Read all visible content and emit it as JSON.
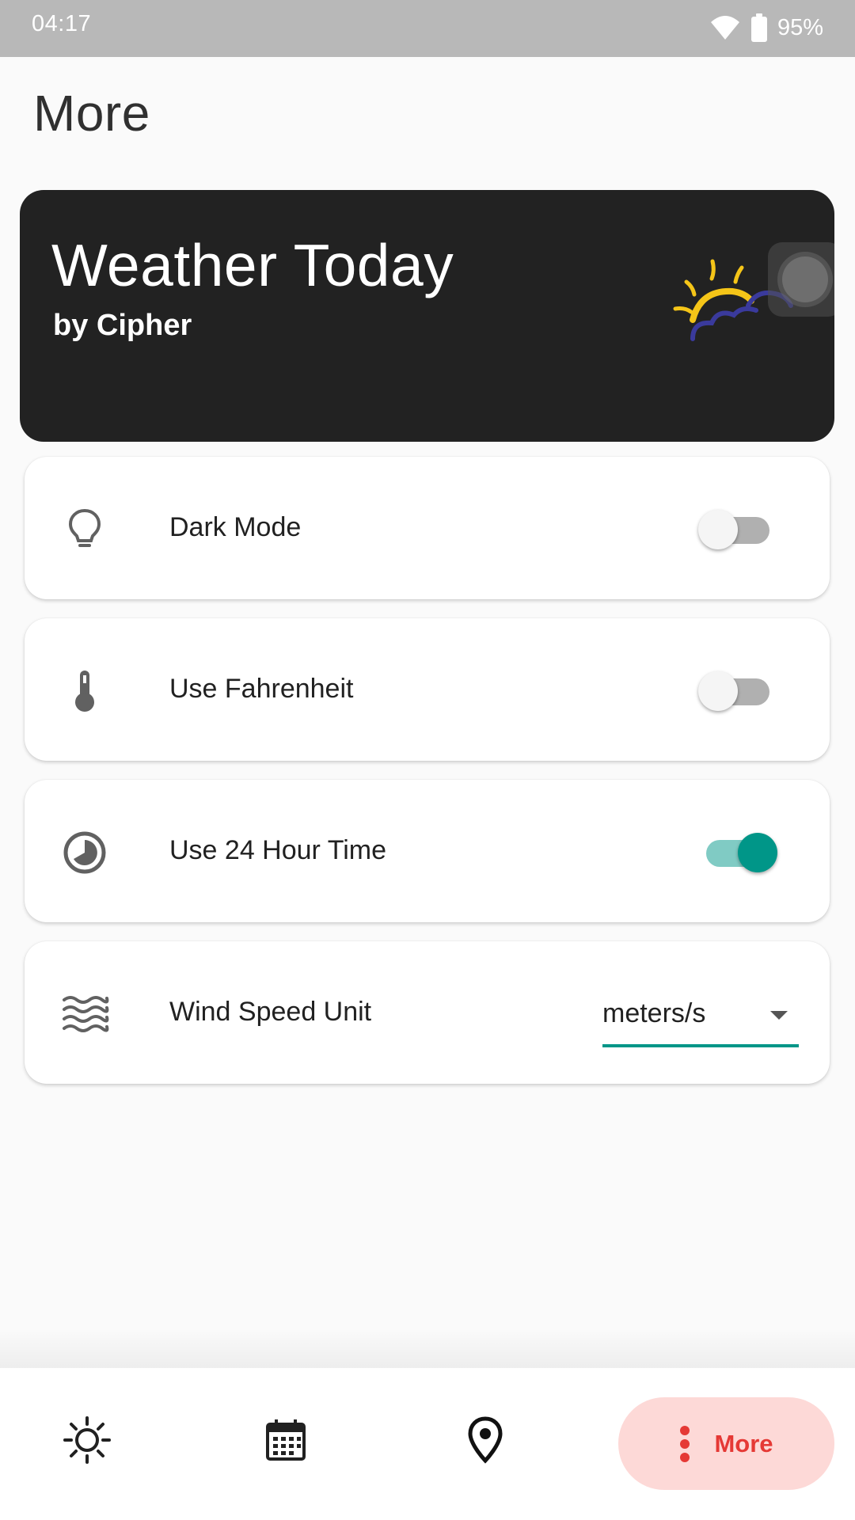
{
  "status_bar": {
    "time": "04:17",
    "battery": "95%",
    "icons": [
      "wifi-icon",
      "battery-icon"
    ]
  },
  "page": {
    "title": "More"
  },
  "header": {
    "app_name": "Weather Today",
    "subtitle": "by Cipher",
    "logo_icon": "sun-cloud-icon"
  },
  "settings": {
    "dark_mode": {
      "label": "Dark Mode",
      "icon": "lightbulb-icon",
      "enabled": false
    },
    "fahrenheit": {
      "label": "Use Fahrenheit",
      "icon": "thermometer-icon",
      "enabled": false
    },
    "hour24": {
      "label": "Use 24 Hour Time",
      "icon": "clock-icon",
      "enabled": true
    },
    "wind_unit": {
      "label": "Wind Speed Unit",
      "icon": "waves-icon",
      "value": "meters/s"
    }
  },
  "nav": {
    "items": [
      "sun-icon",
      "calendar-icon",
      "location-pin-icon",
      "more-vert-icon"
    ],
    "more_label": "More"
  },
  "colors": {
    "accent": "#009688",
    "accent_track": "#80cbc4",
    "header_bg": "#222222",
    "nav_active_bg": "#fdd9d7",
    "nav_active_fg": "#e53935",
    "logo_sun": "#f5c518",
    "logo_cloud": "#3a3a9c"
  }
}
